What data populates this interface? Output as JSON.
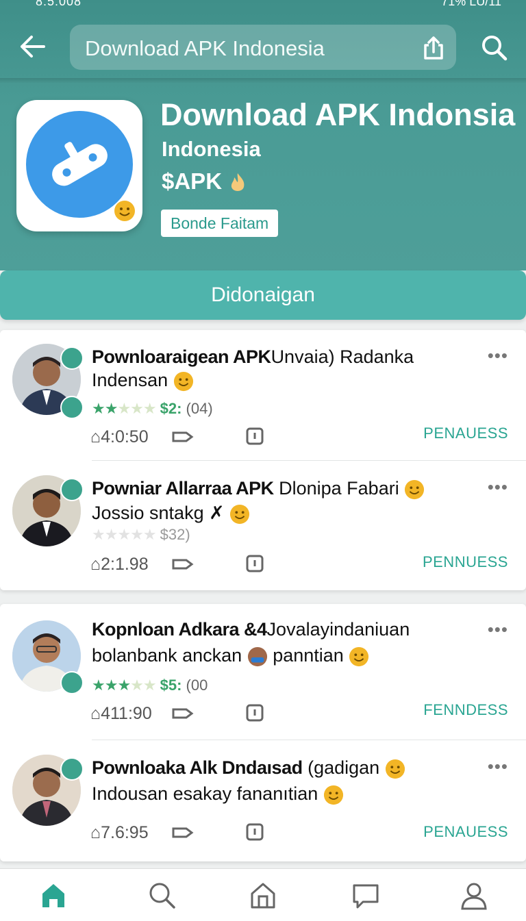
{
  "status": {
    "time": "8:5:008",
    "battery": "71%",
    "right_text": "LU/11"
  },
  "toolbar": {
    "search_text": "Download APK Indonesia"
  },
  "app": {
    "title": "Download APK Indonsia",
    "subtitle": "Indonesia",
    "price": "$APK",
    "tag": "Bonde Faitam",
    "download_label": "Didonaigan",
    "icon_color": "#3d9ae8"
  },
  "items": [
    {
      "title_bold": "Pownloaraigean APK",
      "title_rest": "Unvaia) Radanka",
      "line2": "Indensan",
      "price": "$2:",
      "count": "(04)",
      "filled_stars": 2,
      "time": "4:0:50",
      "action": "PENAUESS"
    },
    {
      "title_bold": "Powniar Allarraa APK",
      "title_rest": "Dlonipa Fabari",
      "line2": "Jossio sntakg",
      "price": "$32)",
      "count": "",
      "filled_stars": 0,
      "time": "2:1.98",
      "action": "PENNUESS"
    },
    {
      "title_bold": "Kopnloan Adkara &4",
      "title_rest": "Jovalayindaniuan",
      "line2": "bolanbank anckan",
      "line2_rest": "panntian",
      "price": "$5:",
      "count": "(00",
      "filled_stars": 3,
      "time": "411:90",
      "action": "FENNDESS"
    },
    {
      "title_bold": "Pownloaka Alk Dndaısad",
      "title_rest": "(gadigan",
      "line2": "Indousan esakay fananıtian",
      "price": "",
      "count": "",
      "filled_stars": 0,
      "time": "7.6:95",
      "action": "PENAUESS"
    }
  ],
  "more_label": "•••",
  "nav": [
    "home-icon",
    "search-icon",
    "store-icon",
    "chat-icon",
    "profile-icon"
  ],
  "colors": {
    "header": "#4a9b95",
    "accent": "#2aa592",
    "button": "#4fb4ac"
  }
}
